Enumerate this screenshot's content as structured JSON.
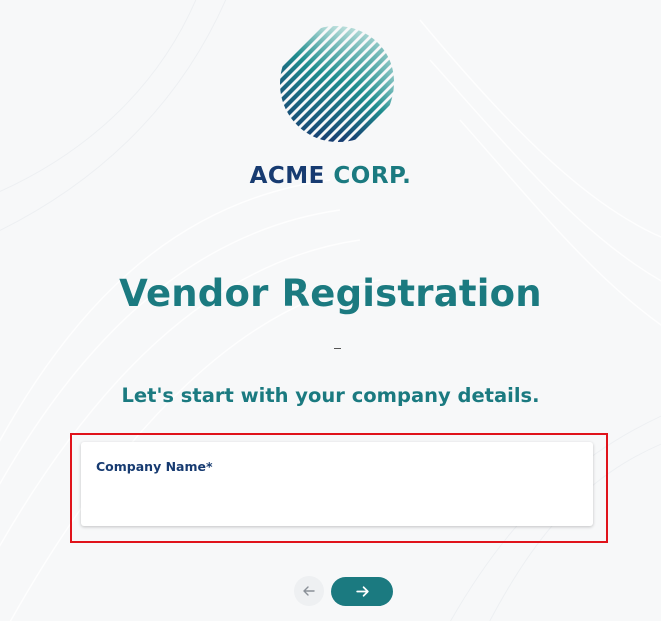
{
  "brand": {
    "name_part1": "ACME",
    "name_part2": "CORP.",
    "logo_icon": "striped-globe-logo",
    "colors": {
      "navy": "#173b71",
      "teal": "#1b7a80",
      "highlight": "#e0131b"
    }
  },
  "header": {
    "title": "Vendor Registration",
    "divider_text": "–",
    "subtitle": "Let's start with your company details."
  },
  "form": {
    "company_name": {
      "label": "Company Name*",
      "value": "",
      "placeholder": ""
    }
  },
  "navigation": {
    "back_icon": "arrow-left-icon",
    "next_icon": "arrow-right-icon"
  }
}
